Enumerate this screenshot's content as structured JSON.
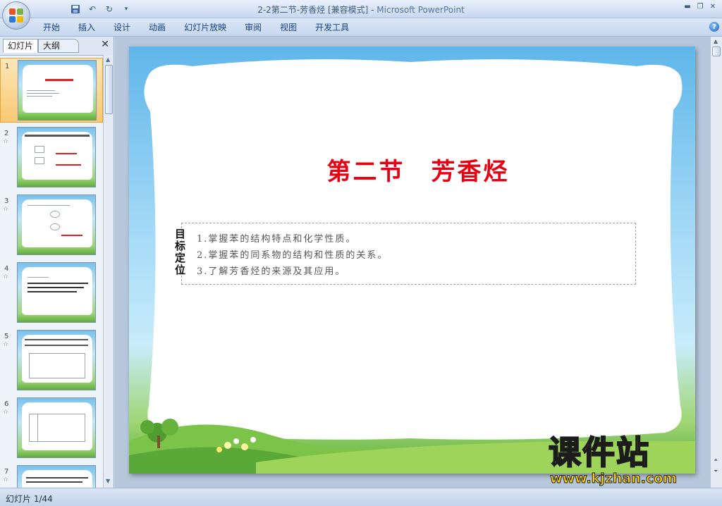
{
  "window": {
    "title": "2-2第二节-芳香烃 [兼容模式] - ",
    "app_name": "Microsoft PowerPoint"
  },
  "ribbon": {
    "tabs": [
      {
        "label": "开始"
      },
      {
        "label": "插入"
      },
      {
        "label": "设计"
      },
      {
        "label": "动画"
      },
      {
        "label": "幻灯片放映"
      },
      {
        "label": "审阅"
      },
      {
        "label": "视图"
      },
      {
        "label": "开发工具"
      }
    ],
    "help_glyph": "?"
  },
  "panel": {
    "tab_slides": "幻灯片",
    "tab_outline": "大纲",
    "close_glyph": "✕",
    "thumbnails": [
      {
        "num": "1",
        "star": ""
      },
      {
        "num": "2",
        "star": "☆"
      },
      {
        "num": "3",
        "star": "☆"
      },
      {
        "num": "4",
        "star": "☆"
      },
      {
        "num": "5",
        "star": "☆"
      },
      {
        "num": "6",
        "star": "☆"
      },
      {
        "num": "7",
        "star": "☆"
      }
    ]
  },
  "slide": {
    "title": "第二节　芳香烃",
    "objective_label": "目标定位",
    "objectives": [
      "1.掌握苯的结构特点和化学性质。",
      "2.掌握苯的同系物的结构和性质的关系。",
      "3.了解芳香烃的来源及其应用。"
    ]
  },
  "watermark": {
    "title": "课件站",
    "url": "www.kjzhan.com"
  },
  "status": {
    "slide_counter": "幻灯片 1/44"
  },
  "colors": {
    "title_red": "#e60012",
    "watermark_yellow": "#ffd200",
    "ribbon_text": "#15428b"
  }
}
